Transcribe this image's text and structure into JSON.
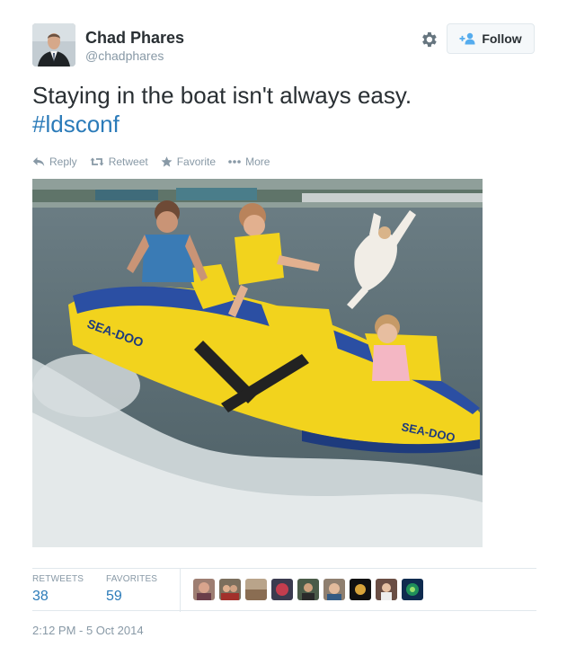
{
  "user": {
    "full_name": "Chad Phares",
    "username": "@chadphares",
    "avatar_icon": "profile-photo"
  },
  "header": {
    "gear_icon": "gear-icon",
    "follow_label": "Follow",
    "follow_icon": "add-user-icon"
  },
  "tweet": {
    "text": "Staying in the boat isn't always easy.",
    "hashtag": "#ldsconf",
    "photo_description": "Kids and a cat flying off an inflatable tube on a lake"
  },
  "actions": {
    "reply_label": "Reply",
    "retweet_label": "Retweet",
    "favorite_label": "Favorite",
    "more_label": "More"
  },
  "stats": {
    "retweets_label": "RETWEETS",
    "retweets_count": "38",
    "favorites_label": "FAVORITES",
    "favorites_count": "59",
    "favoriter_avatar_count": 9
  },
  "timestamp": "2:12 PM - 5 Oct 2014",
  "colors": {
    "text": "#292f33",
    "muted": "#8899a6",
    "link": "#2b7bb9",
    "border": "#e1e8ed"
  }
}
